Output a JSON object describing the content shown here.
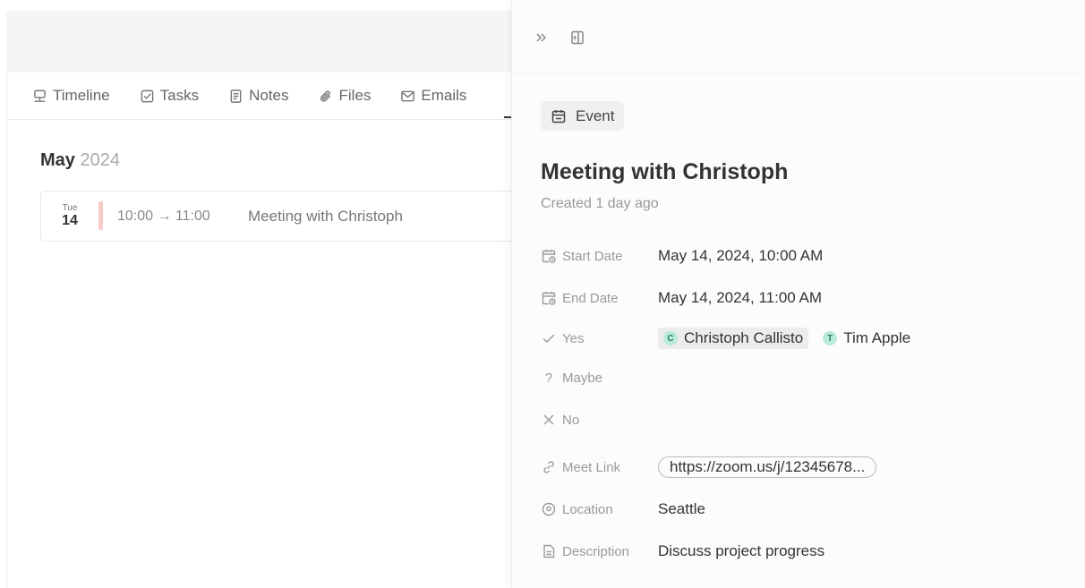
{
  "left": {
    "tabs": [
      {
        "label": "Timeline",
        "icon": "timeline-icon"
      },
      {
        "label": "Tasks",
        "icon": "tasks-icon"
      },
      {
        "label": "Notes",
        "icon": "notes-icon"
      },
      {
        "label": "Files",
        "icon": "files-icon"
      },
      {
        "label": "Emails",
        "icon": "emails-icon"
      }
    ],
    "month": "May",
    "year": "2024",
    "event": {
      "dow": "Tue",
      "day": "14",
      "time": "10:00 → 11:00",
      "name": "Meeting with Christoph",
      "bar_color": "#f6cbc8"
    }
  },
  "panel": {
    "type_label": "Event",
    "title": "Meeting with Christoph",
    "created": "Created 1 day ago",
    "fields": {
      "start_date": {
        "label": "Start Date",
        "value": "May 14, 2024, 10:00 AM"
      },
      "end_date": {
        "label": "End Date",
        "value": "May 14, 2024, 11:00 AM"
      },
      "yes": {
        "label": "Yes",
        "people": [
          {
            "initial": "C",
            "name": "Christoph Callisto"
          },
          {
            "initial": "T",
            "name": "Tim Apple"
          }
        ]
      },
      "maybe": {
        "label": "Maybe"
      },
      "no": {
        "label": "No"
      },
      "meet_link": {
        "label": "Meet Link",
        "value": "https://zoom.us/j/12345678..."
      },
      "location": {
        "label": "Location",
        "value": "Seattle"
      },
      "description": {
        "label": "Description",
        "value": "Discuss project progress"
      }
    },
    "avatar_color": "#b9ecd9"
  }
}
